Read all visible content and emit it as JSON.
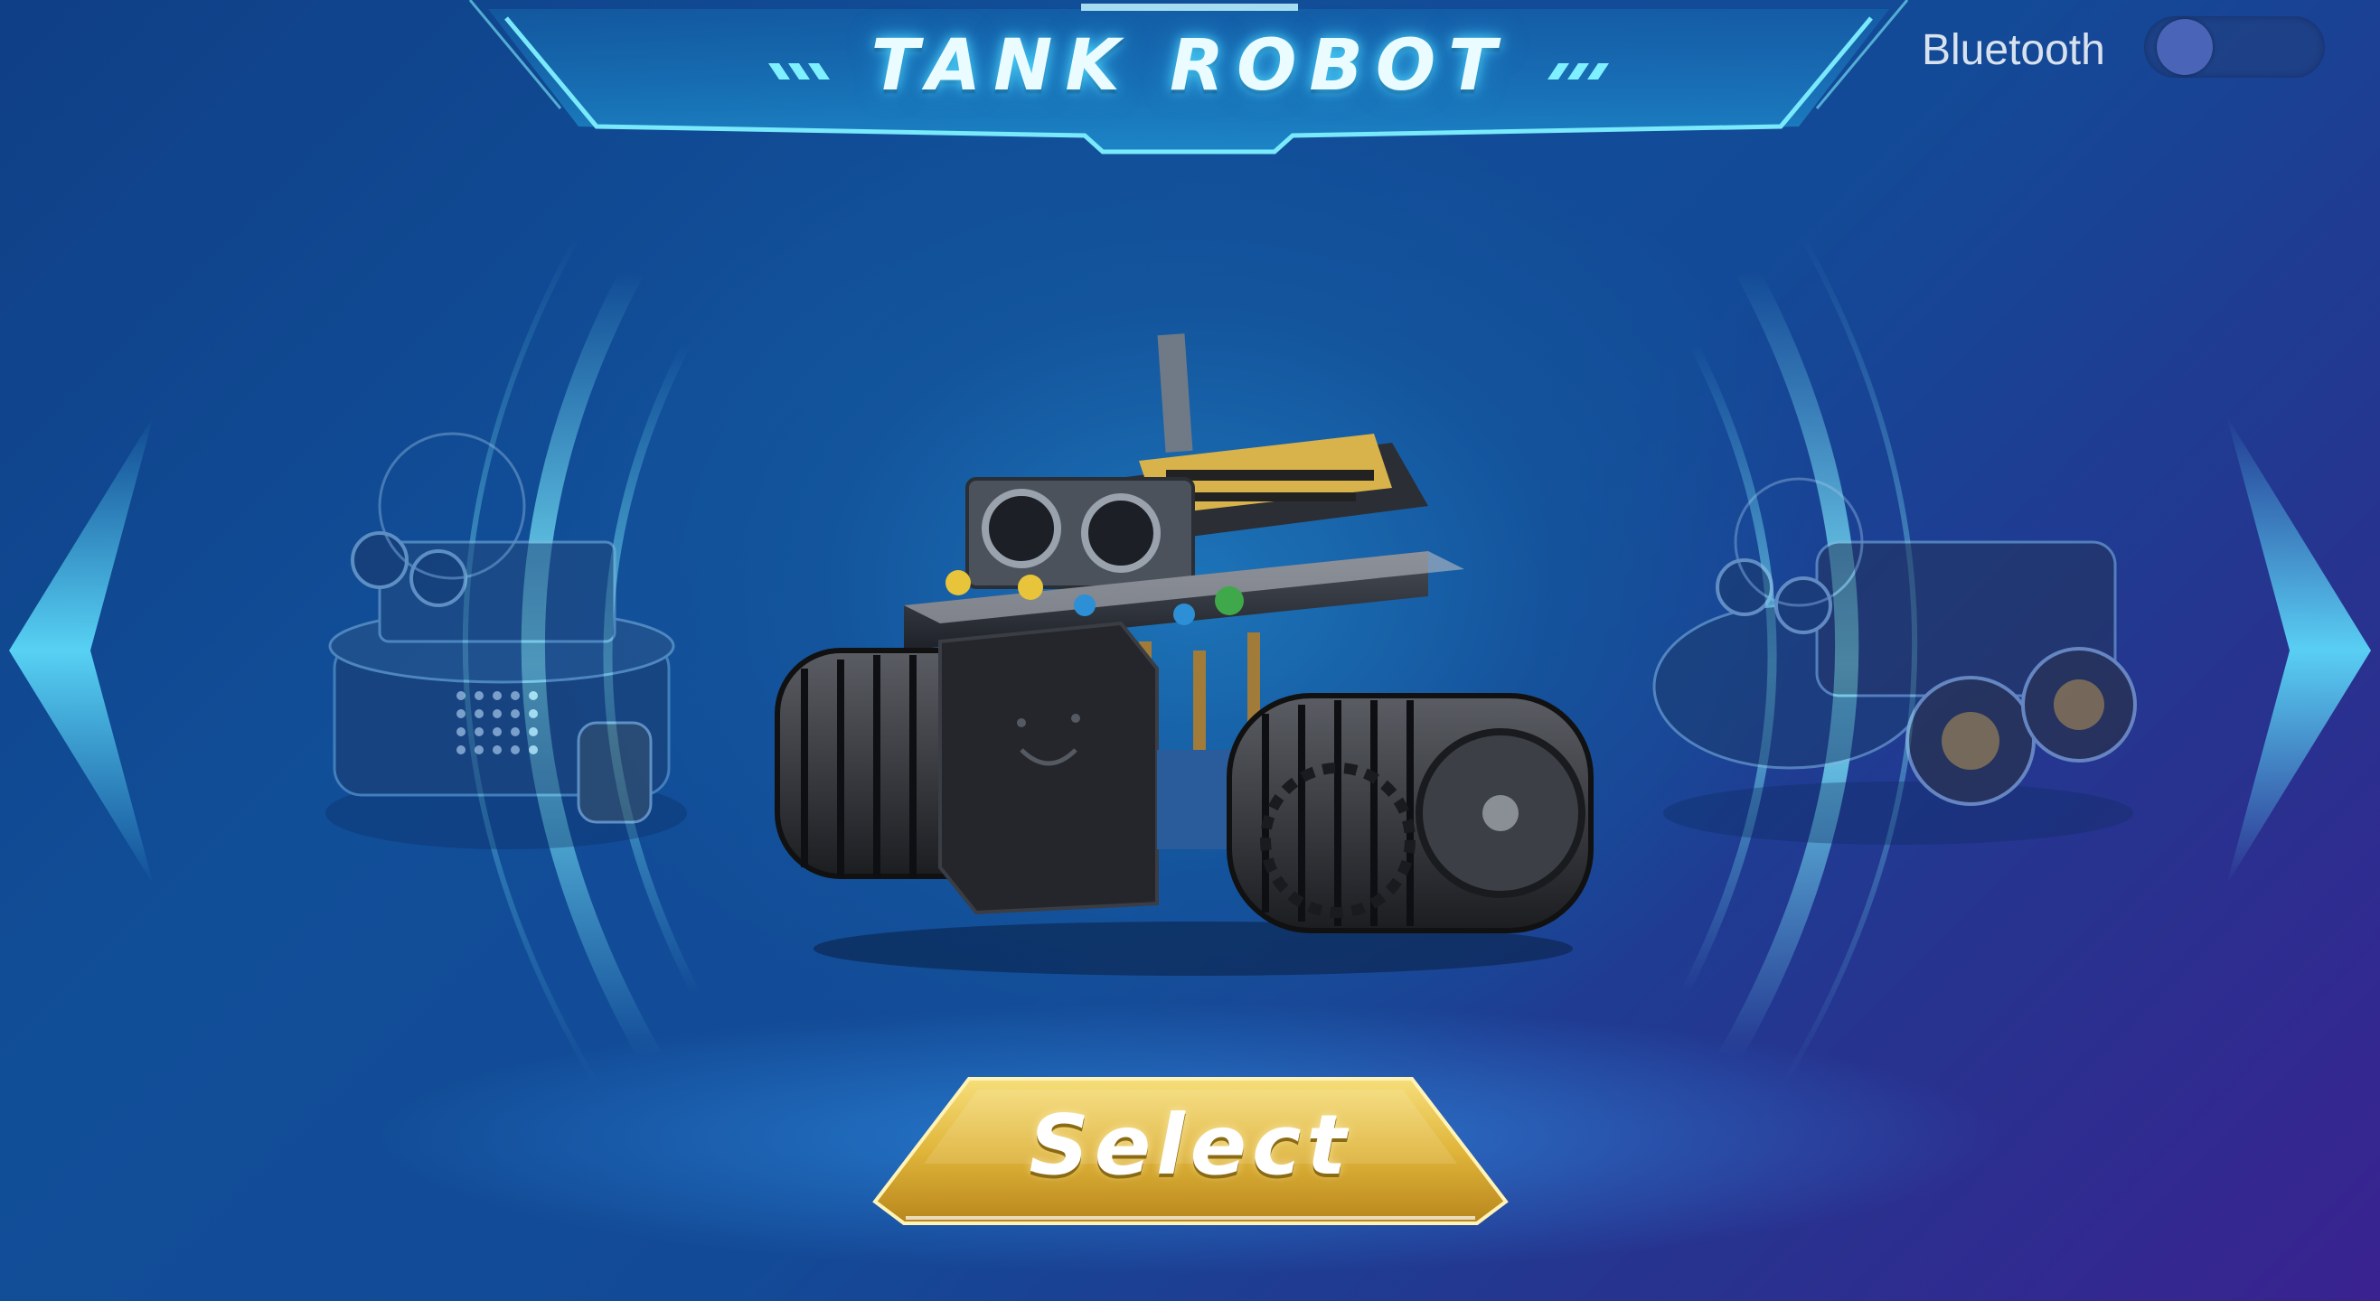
{
  "header": {
    "title": "TANK ROBOT"
  },
  "bluetooth": {
    "label": "Bluetooth",
    "enabled": false
  },
  "robot": {
    "name": "TANK ROBOT"
  },
  "select_button": {
    "label": "Select"
  },
  "colors": {
    "accent_cyan": "#41d8ff",
    "select_gold": "#e8c44a",
    "toggle_knob": "#4a64b8"
  }
}
